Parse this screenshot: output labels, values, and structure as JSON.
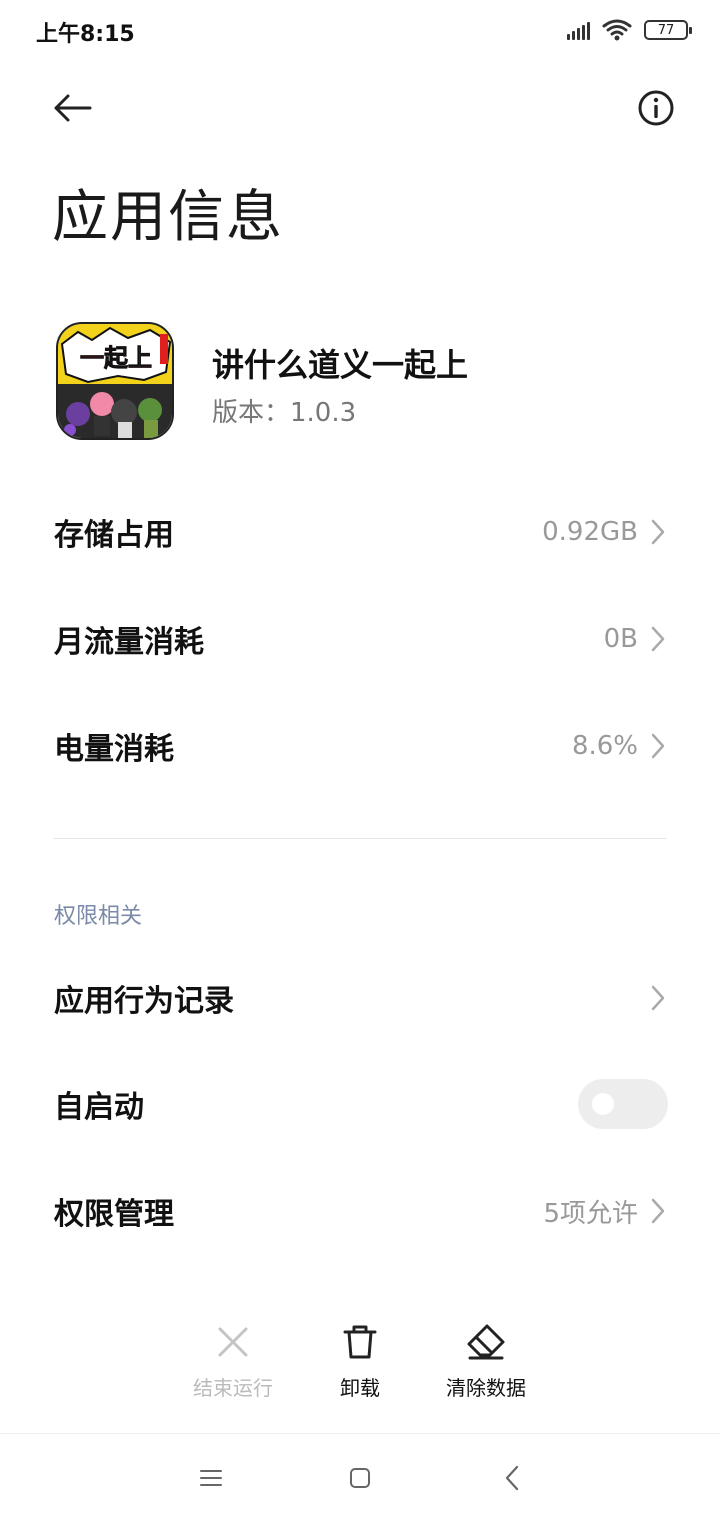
{
  "status_bar": {
    "time": "上午8:15",
    "battery_level": "77",
    "icons": [
      "signal-icon",
      "wifi-icon",
      "battery-icon"
    ]
  },
  "header": {
    "back_icon": "arrow-left-icon",
    "info_icon": "info-icon",
    "title": "应用信息"
  },
  "app": {
    "name": "讲什么道义一起上",
    "version": "版本：1.0.3",
    "icon_text": "一起上"
  },
  "stats": [
    {
      "label": "存储占用",
      "value": "0.92GB"
    },
    {
      "label": "月流量消耗",
      "value": "0B"
    },
    {
      "label": "电量消耗",
      "value": "8.6%"
    }
  ],
  "permissions": {
    "section_title": "权限相关",
    "behavior_log": {
      "label": "应用行为记录"
    },
    "autostart": {
      "label": "自启动",
      "enabled": false
    },
    "manage": {
      "label": "权限管理",
      "value": "5项允许"
    }
  },
  "actions": {
    "force_stop": {
      "label": "结束运行",
      "enabled": false
    },
    "uninstall": {
      "label": "卸载"
    },
    "clear_data": {
      "label": "清除数据"
    }
  },
  "nav_bar": {
    "icons": [
      "menu-icon",
      "home-icon",
      "back-icon"
    ]
  },
  "colors": {
    "accent_section": "#7a8aa8",
    "value_gray": "#999999",
    "toggle_off": "#ededed"
  }
}
